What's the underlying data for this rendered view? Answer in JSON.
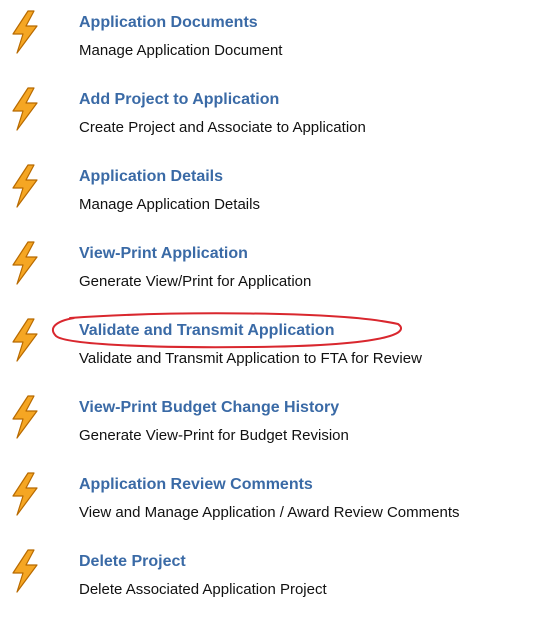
{
  "colors": {
    "link": "#3a6aa6",
    "text": "#111111",
    "icon_fill": "#f5a623",
    "icon_stroke": "#b86a00",
    "highlight": "#d9272e"
  },
  "icon": "lightning-bolt-icon",
  "items": [
    {
      "title": "Application Documents",
      "desc": "Manage Application Document"
    },
    {
      "title": "Add Project to Application",
      "desc": "Create Project and Associate to Application"
    },
    {
      "title": "Application Details",
      "desc": "Manage Application Details"
    },
    {
      "title": "View-Print Application",
      "desc": "Generate View/Print for Application"
    },
    {
      "title": "Validate and Transmit Application",
      "desc": "Validate and Transmit Application to FTA for Review"
    },
    {
      "title": "View-Print Budget Change History",
      "desc": "Generate View-Print for Budget Revision"
    },
    {
      "title": "Application Review Comments",
      "desc": "View and Manage Application / Award Review Comments"
    },
    {
      "title": "Delete Project",
      "desc": "Delete Associated Application Project"
    }
  ]
}
